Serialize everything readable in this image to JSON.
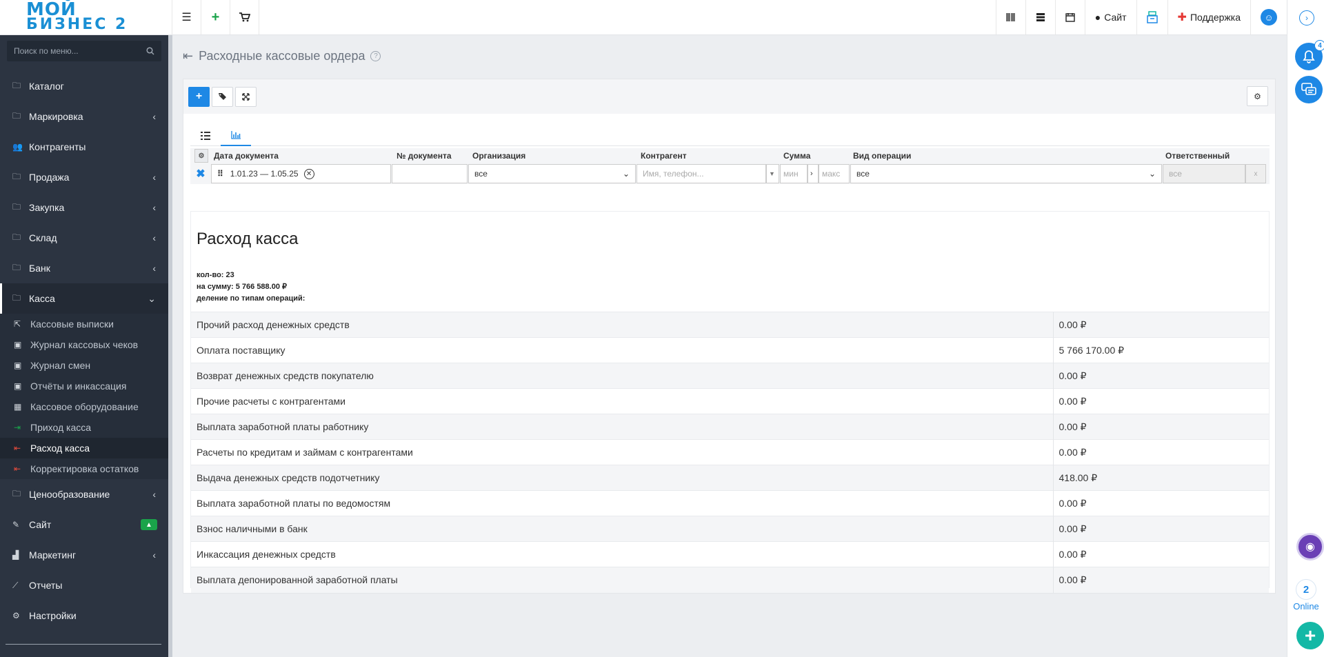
{
  "logo": {
    "line1": "МОЙ",
    "line2": "БИЗНЕС 2"
  },
  "topbar": {
    "menu_icon": "☰",
    "add_icon": "+",
    "cart_icon": "🛒",
    "site_label": "Сайт",
    "support_label": "Поддержка"
  },
  "sidebar": {
    "search_placeholder": "Поиск по меню...",
    "items": [
      {
        "label": "Каталог",
        "icon": "folder-icon",
        "chevron": false
      },
      {
        "label": "Маркировка",
        "icon": "folder-icon",
        "chevron": true
      },
      {
        "label": "Контрагенты",
        "icon": "users-icon",
        "chevron": false
      },
      {
        "label": "Продажа",
        "icon": "folder-icon",
        "chevron": true
      },
      {
        "label": "Закупка",
        "icon": "folder-icon",
        "chevron": true
      },
      {
        "label": "Склад",
        "icon": "folder-icon",
        "chevron": true
      },
      {
        "label": "Банк",
        "icon": "folder-icon",
        "chevron": true
      },
      {
        "label": "Касса",
        "icon": "folder-icon",
        "chevron": true
      }
    ],
    "subitems": [
      {
        "label": "Кассовые выписки",
        "icon": "export-icon"
      },
      {
        "label": "Журнал кассовых чеков",
        "icon": "money-icon"
      },
      {
        "label": "Журнал смен",
        "icon": "money-icon"
      },
      {
        "label": "Отчёты и инкассация",
        "icon": "money-icon"
      },
      {
        "label": "Кассовое оборудование",
        "icon": "calculator-icon"
      },
      {
        "label": "Приход касса",
        "icon": "sign-in-icon"
      },
      {
        "label": "Расход касса",
        "icon": "sign-out-icon"
      },
      {
        "label": "Корректировка остатков",
        "icon": "sign-out-icon"
      }
    ],
    "items_after": [
      {
        "label": "Ценообразование",
        "icon": "folder-icon",
        "chevron": true
      },
      {
        "label": "Сайт",
        "icon": "magic-icon",
        "chevron": false
      },
      {
        "label": "Маркетинг",
        "icon": "chart-icon",
        "chevron": true
      },
      {
        "label": "Отчеты",
        "icon": "line-chart-icon",
        "chevron": false
      },
      {
        "label": "Настройки",
        "icon": "gear-icon",
        "chevron": false
      }
    ]
  },
  "page": {
    "title": "Расходные кассовые ордера"
  },
  "filters": {
    "headers": {
      "date": "Дата документа",
      "number": "№ документа",
      "org": "Организация",
      "contractor": "Контрагент",
      "sum": "Сумма",
      "op_type": "Вид операции",
      "responsible": "Ответственный"
    },
    "date_value": "1.01.23 — 1.05.25",
    "org_value": "все",
    "contractor_placeholder": "Имя, телефон...",
    "sum_min_placeholder": "мин",
    "sum_max_placeholder": "макс",
    "op_type_value": "все",
    "responsible_value": "все",
    "responsible_clear": "x"
  },
  "report": {
    "title": "Расход касса",
    "count_line": "кол-во: 23",
    "sum_line": "на сумму: 5 766 588.00 ₽",
    "split_line": "деление по типам операций:",
    "rows": [
      {
        "name": "Прочий расход денежных средств",
        "amount": "0.00 ₽"
      },
      {
        "name": "Оплата поставщику",
        "amount": "5 766 170.00 ₽"
      },
      {
        "name": "Возврат денежных средств покупателю",
        "amount": "0.00 ₽"
      },
      {
        "name": "Прочие расчеты с контрагентами",
        "amount": "0.00 ₽"
      },
      {
        "name": "Выплата заработной платы работнику",
        "amount": "0.00 ₽"
      },
      {
        "name": "Расчеты по кредитам и займам с контрагентами",
        "amount": "0.00 ₽"
      },
      {
        "name": "Выдача денежных средств подотчетнику",
        "amount": "418.00 ₽"
      },
      {
        "name": "Выплата заработной платы по ведомостям",
        "amount": "0.00 ₽"
      },
      {
        "name": "Взнос наличными в банк",
        "amount": "0.00 ₽"
      },
      {
        "name": "Инкассация денежных средств",
        "amount": "0.00 ₽"
      },
      {
        "name": "Выплата депонированной заработной платы",
        "amount": "0.00 ₽"
      }
    ]
  },
  "rightrail": {
    "notification_count": "4",
    "online_count": "2",
    "online_label": "Online"
  },
  "colors": {
    "accent": "#1e88e5",
    "sidebar_bg": "#2c3441",
    "success": "#1aa34a",
    "danger": "#e84c3d"
  }
}
